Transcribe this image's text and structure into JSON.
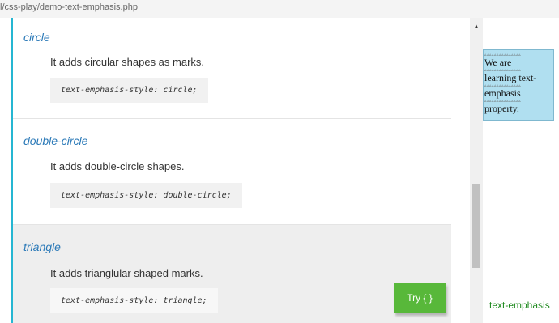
{
  "url": "l/css-play/demo-text-emphasis.php",
  "sections": [
    {
      "title": "circle",
      "description": "It adds circular shapes as marks.",
      "code": "text-emphasis-style: circle;"
    },
    {
      "title": "double-circle",
      "description": "It adds double-circle shapes.",
      "code": "text-emphasis-style: double-circle;"
    },
    {
      "title": "triangle",
      "description": "It adds trianglular shaped marks.",
      "code": "text-emphasis-style: triangle;"
    }
  ],
  "try_button": "Try { }",
  "demo": {
    "lines": [
      "We are",
      "learning text-",
      "emphasis",
      "property."
    ],
    "emphasis_marks": "▵▵▵▵▵▵▵▵▵▵▵▵▵▵▵",
    "caption": "text-emphasis"
  },
  "colors": {
    "accent": "#25b6d2",
    "title_link": "#2c7ab8",
    "try_button_bg": "#58b83a",
    "demo_bg": "#b0dff0",
    "caption": "#1f8a1f"
  }
}
